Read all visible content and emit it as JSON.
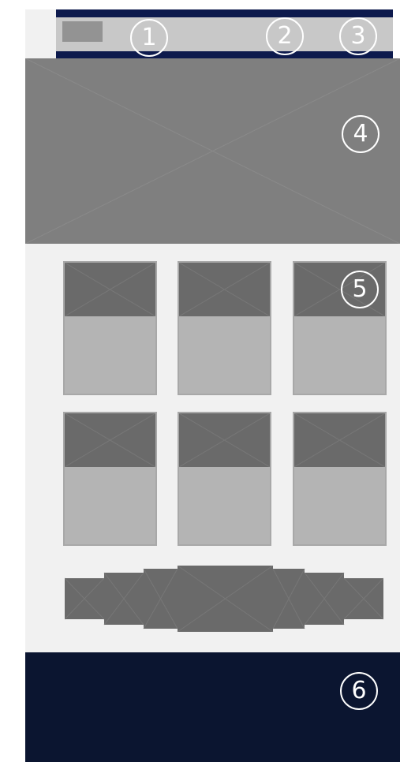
{
  "markers": {
    "header_logo": "1",
    "header_middle": "2",
    "header_right": "3",
    "hero": "4",
    "content_grid": "5",
    "footer": "6"
  },
  "colors": {
    "header_navy": "#0d1a4d",
    "footer_navy": "#0b1530",
    "hero_gray": "#7f7f7f",
    "content_bg": "#f1f1f1",
    "card_gray": "#b4b4b4",
    "placeholder_dark": "#6a6a6a"
  }
}
